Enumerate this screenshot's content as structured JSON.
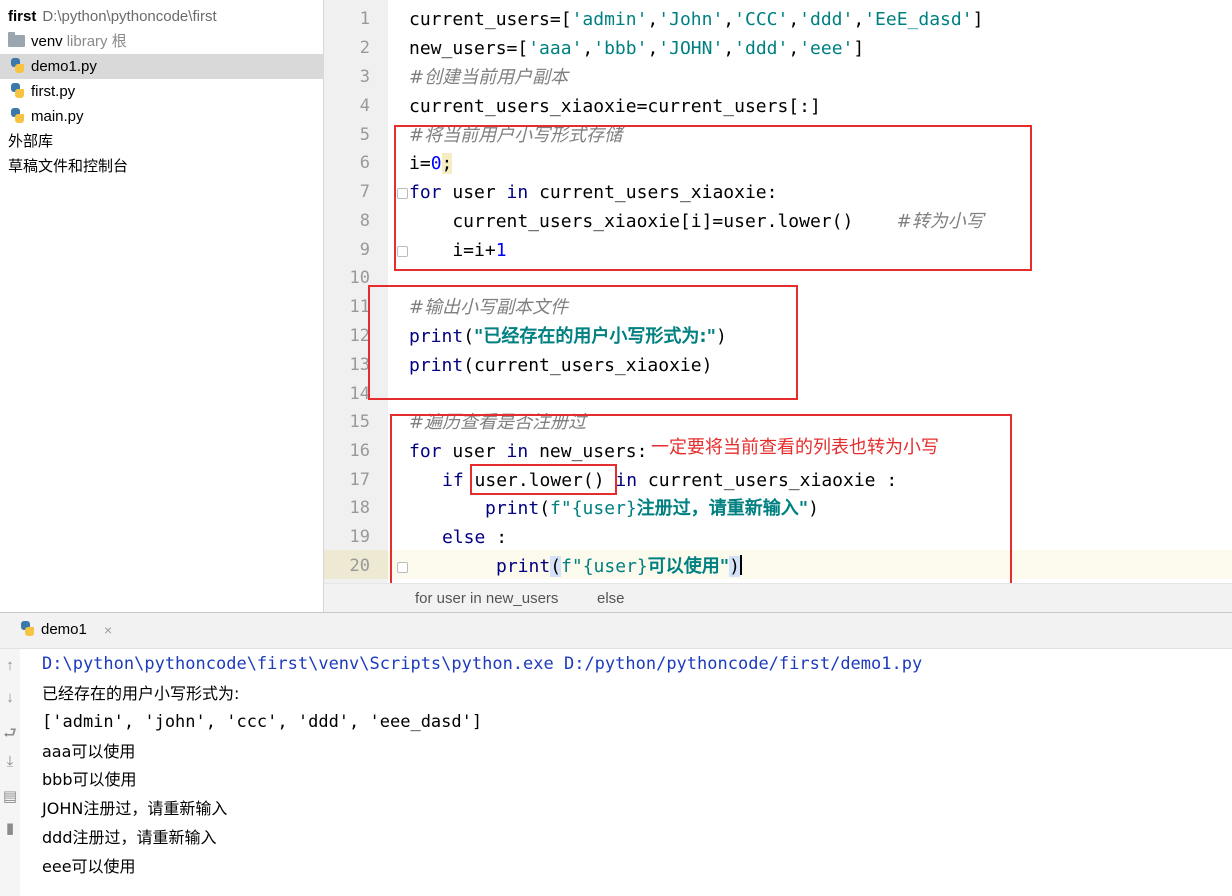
{
  "project": {
    "root_name": "first",
    "root_path": "D:\\python\\pythoncode\\first",
    "items": [
      {
        "label": "venv",
        "suffix": "library 根"
      },
      {
        "label": "demo1.py"
      },
      {
        "label": "first.py"
      },
      {
        "label": "main.py"
      },
      {
        "label": "外部库"
      },
      {
        "label": "草稿文件和控制台"
      }
    ]
  },
  "editor": {
    "line_numbers": [
      "1",
      "2",
      "3",
      "4",
      "5",
      "6",
      "7",
      "8",
      "9",
      "10",
      "11",
      "12",
      "13",
      "14",
      "15",
      "16",
      "17",
      "18",
      "19",
      "20"
    ],
    "code": {
      "l1": {
        "a": "current_users=[",
        "b": "'admin'",
        "c": ",",
        "d": "'John'",
        "e": ",",
        "f": "'CCC'",
        "g": ",",
        "h": "'ddd'",
        "i": ",",
        "j": "'EeE_dasd'",
        "k": "]"
      },
      "l2": {
        "a": "new_users=[",
        "b": "'aaa'",
        "c": ",",
        "d": "'bbb'",
        "e": ",",
        "f": "'JOHN'",
        "g": ",",
        "h": "'ddd'",
        "i": ",",
        "j": "'eee'",
        "k": "]"
      },
      "l3": {
        "cm": "#创建当前用户副本"
      },
      "l4": {
        "a": "current_users_xiaoxie=current_users[:]"
      },
      "l5": {
        "cm": "#将当前用户小写形式存储"
      },
      "l6": {
        "a": "i=",
        "num": "0",
        "semi": ";"
      },
      "l7": {
        "kw1": "for",
        "a": " user ",
        "kw2": "in",
        "b": " current_users_xiaoxie:"
      },
      "l8": {
        "a": "    current_users_xiaoxie[i]=user.lower()    ",
        "cm": "#转为小写"
      },
      "l9": {
        "a": "    i=i+",
        "num": "1"
      },
      "l11": {
        "cm": "#输出小写副本文件"
      },
      "l12": {
        "kw": "print",
        "a": "(",
        "str": "\"已经存在的用户小写形式为:\"",
        "b": ")"
      },
      "l13": {
        "kw": "print",
        "a": "(current_users_xiaoxie)"
      },
      "l15": {
        "cm": "#遍历查看是否注册过"
      },
      "l16": {
        "kw1": "for",
        "a": " user ",
        "kw2": "in",
        "b": " new_users:"
      },
      "l17": {
        "kw1": "if",
        "a": " user.lower() ",
        "kw2": "in",
        "b": " current_users_xiaoxie :"
      },
      "l18": {
        "kw": "print",
        "a": "(",
        "s1": "f\"",
        "b": "{user}",
        "s2": "注册过，请重新输入\"",
        "c": ")"
      },
      "l19": {
        "kw": "else",
        "a": " :"
      },
      "l20": {
        "kw": "print",
        "p": "(",
        "s1": "f\"",
        "b": "{user}",
        "s2": "可以使用\"",
        "c": ")"
      }
    },
    "annotation": "一定要将当前查看的列表也转为小写",
    "breadcrumb": {
      "first": "for user in new_users",
      "second": "else"
    }
  },
  "run": {
    "tab_label": "demo1",
    "close_label": "×",
    "output": [
      "D:\\python\\pythoncode\\first\\venv\\Scripts\\python.exe D:/python/pythoncode/first/demo1.py",
      "已经存在的用户小写形式为:",
      "['admin', 'john', 'ccc', 'ddd', 'eee_dasd']",
      "aaa可以使用",
      "bbb可以使用",
      "JOHN注册过，请重新输入",
      "ddd注册过，请重新输入",
      "eee可以使用"
    ],
    "toolbar_icons": [
      "arrow-up-icon",
      "arrow-down-icon",
      "soft-wrap-icon",
      "scroll-to-end-icon",
      "print-icon",
      "trash-icon"
    ]
  }
}
